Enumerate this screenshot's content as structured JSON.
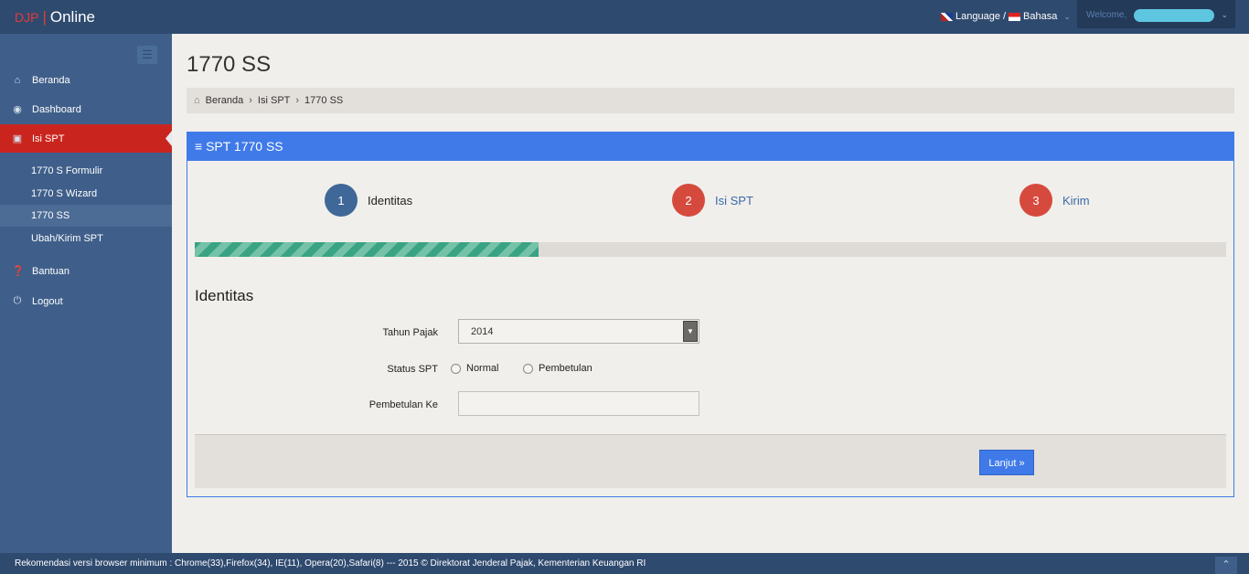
{
  "topbar": {
    "brand_djp": "DJP",
    "brand_sep": "|",
    "brand_online": "Online",
    "language_label": "Language",
    "language_sep": "/",
    "bahasa_label": "Bahasa",
    "welcome_label": "Welcome,"
  },
  "sidebar": {
    "items": [
      {
        "label": "Beranda",
        "icon": "home-icon"
      },
      {
        "label": "Dashboard",
        "icon": "dashboard-icon"
      },
      {
        "label": "Isi SPT",
        "icon": "document-icon"
      },
      {
        "label": "Bantuan",
        "icon": "help-icon"
      },
      {
        "label": "Logout",
        "icon": "power-icon"
      }
    ],
    "subitems": [
      {
        "label": "1770 S Formulir"
      },
      {
        "label": "1770 S Wizard"
      },
      {
        "label": "1770 SS"
      },
      {
        "label": "Ubah/Kirim SPT"
      }
    ]
  },
  "main": {
    "title": "1770 SS",
    "breadcrumb": [
      "Beranda",
      "Isi SPT",
      "1770 SS"
    ],
    "panel_title": "SPT 1770 SS",
    "steps": [
      {
        "number": "1",
        "label": "Identitas"
      },
      {
        "number": "2",
        "label": "Isi SPT"
      },
      {
        "number": "3",
        "label": "Kirim"
      }
    ],
    "progress": 0.333,
    "section_title": "Identitas",
    "form": {
      "tahun_label": "Tahun Pajak",
      "tahun_value": "2014",
      "status_label": "Status SPT",
      "status_options": [
        "Normal",
        "Pembetulan"
      ],
      "pembetulan_label": "Pembetulan Ke",
      "pembetulan_value": ""
    },
    "next_button": "Lanjut »"
  },
  "footer": {
    "text": "Rekomendasi versi browser minimum : Chrome(33),Firefox(34), IE(11), Opera(20),Safari(8) --- 2015 © Direktorat Jenderal Pajak, Kementerian Keuangan RI"
  },
  "colors": {
    "topbar": "#2f4a6f",
    "sidebar": "#3f5f8a",
    "active": "#c9251e",
    "accent": "#3f7ae8",
    "progress": "#3aa384"
  }
}
